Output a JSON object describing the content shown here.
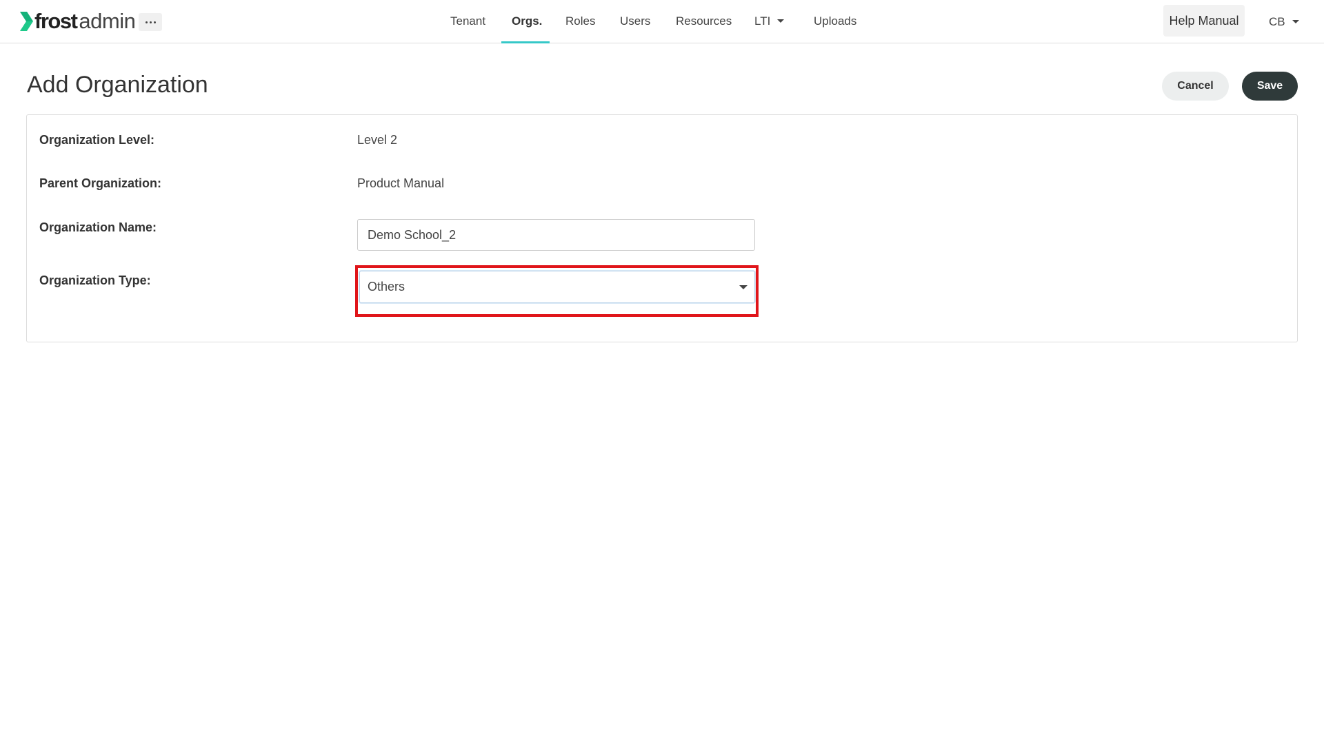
{
  "brand": {
    "name_bold": "frost",
    "name_light": "admin",
    "accent_color": "#35c8c8",
    "logo_color": "#1ec98a"
  },
  "header": {
    "more_icon": "ellipsis-icon",
    "nav": [
      {
        "label": "Tenant",
        "active": false
      },
      {
        "label": "Orgs.",
        "active": true
      },
      {
        "label": "Roles",
        "active": false
      },
      {
        "label": "Users",
        "active": false
      },
      {
        "label": "Resources",
        "active": false
      },
      {
        "label": "LTI",
        "active": false,
        "dropdown": true
      },
      {
        "label": "Uploads",
        "active": false
      }
    ],
    "help_label": "Help Manual",
    "user_initials": "CB"
  },
  "page": {
    "title": "Add Organization",
    "cancel_label": "Cancel",
    "save_label": "Save"
  },
  "form": {
    "level_label": "Organization Level:",
    "level_value": "Level 2",
    "parent_label": "Parent Organization:",
    "parent_value": "Product Manual",
    "name_label": "Organization Name:",
    "name_value": "Demo School_2",
    "type_label": "Organization Type:",
    "type_value": "Others",
    "highlight_color": "#e0151a"
  }
}
